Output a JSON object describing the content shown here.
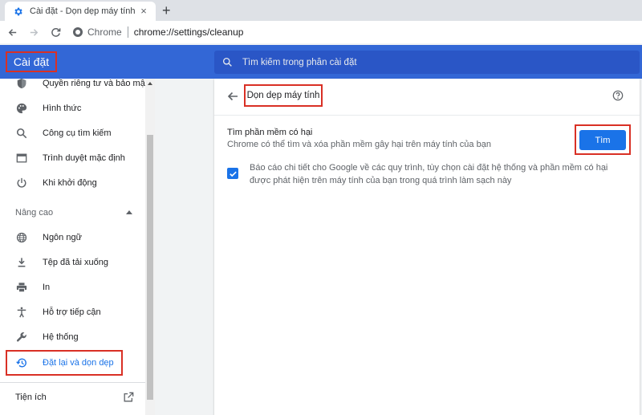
{
  "browser": {
    "tab_title": "Cài đặt - Dọn dẹp máy tính",
    "tab_close": "×",
    "new_tab": "+",
    "address_chip": "Chrome",
    "address_url": "chrome://settings/cleanup"
  },
  "header": {
    "title": "Cài đặt",
    "search_placeholder": "Tìm kiếm trong phần cài đặt"
  },
  "sidebar": {
    "items_top": [
      {
        "label": "Quyền riêng tư và bảo mật",
        "icon": "shield-icon"
      },
      {
        "label": "Hình thức",
        "icon": "palette-icon"
      },
      {
        "label": "Công cụ tìm kiếm",
        "icon": "search-icon"
      },
      {
        "label": "Trình duyệt mặc định",
        "icon": "browser-window-icon"
      },
      {
        "label": "Khi khởi động",
        "icon": "power-icon"
      }
    ],
    "advanced_label": "Nâng cao",
    "items_advanced": [
      {
        "label": "Ngôn ngữ",
        "icon": "globe-icon"
      },
      {
        "label": "Tệp đã tải xuống",
        "icon": "download-icon"
      },
      {
        "label": "In",
        "icon": "printer-icon"
      },
      {
        "label": "Hỗ trợ tiếp cận",
        "icon": "accessibility-icon"
      },
      {
        "label": "Hệ thống",
        "icon": "wrench-icon"
      },
      {
        "label": "Đặt lại và dọn dẹp",
        "icon": "history-icon",
        "active": true
      }
    ],
    "extensions_label": "Tiện ích"
  },
  "main": {
    "page_title": "Dọn dẹp máy tính",
    "section_title": "Tìm phần mềm có hại",
    "section_desc": "Chrome có thể tìm và xóa phần mềm gây hại trên máy tính của bạn",
    "find_button": "Tìm",
    "report_checked": true,
    "report_label": "Báo cáo chi tiết cho Google về các quy trình, tùy chọn cài đặt hệ thống và phần mềm có hại được phát hiện trên máy tính của bạn trong quá trình làm sạch này"
  },
  "colors": {
    "header_blue": "#3367d6",
    "accent_blue": "#1a73e8",
    "highlight_red": "#d93025"
  }
}
